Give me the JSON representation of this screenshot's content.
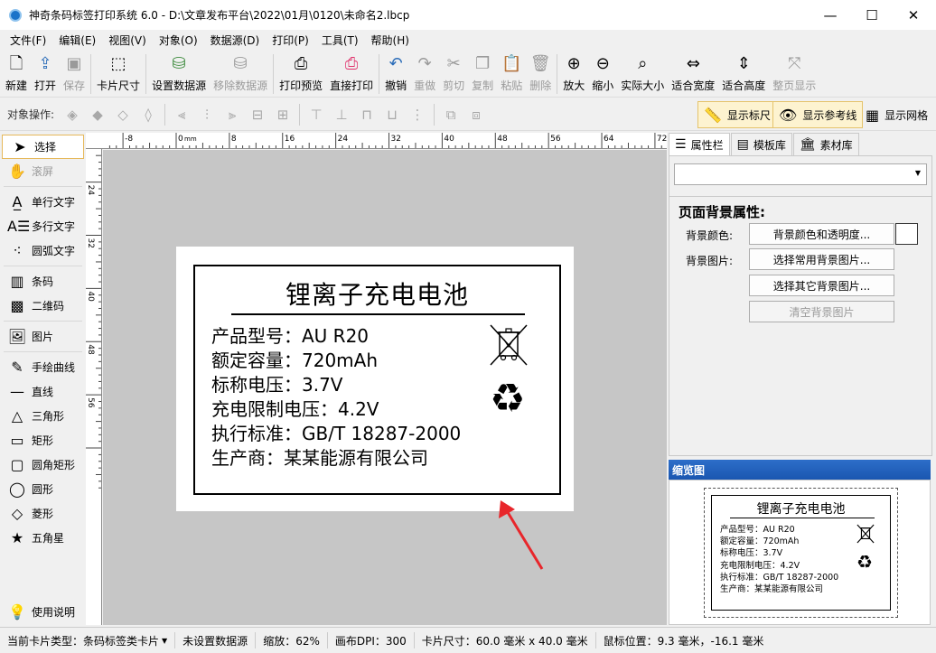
{
  "window": {
    "title": "神奇条码标签打印系统 6.0 - D:\\文章发布平台\\2022\\01月\\0120\\未命名2.lbcp",
    "minimize_glyph": "—",
    "maximize_glyph": "☐",
    "close_glyph": "✕"
  },
  "menu": [
    "文件(F)",
    "编辑(E)",
    "视图(V)",
    "对象(O)",
    "数据源(D)",
    "打印(P)",
    "工具(T)",
    "帮助(H)"
  ],
  "toolbar": {
    "new": "新建",
    "open": "打开",
    "save": "保存",
    "card_size": "卡片尺寸",
    "set_datasource": "设置数据源",
    "remove_datasource": "移除数据源",
    "print_preview": "打印预览",
    "direct_print": "直接打印",
    "undo": "撤销",
    "redo": "重做",
    "cut": "剪切",
    "copy": "复制",
    "paste": "粘贴",
    "delete": "删除",
    "zoom_in": "放大",
    "zoom_out": "缩小",
    "actual_size": "实际大小",
    "fit_width": "适合宽度",
    "fit_height": "适合高度",
    "fit_page": "整页显示"
  },
  "ops": {
    "label": "对象操作:",
    "show_ruler": "显示标尺",
    "show_guides": "显示参考线",
    "show_grid": "显示网格"
  },
  "palette": {
    "select": "选择",
    "scroll": "滚屏",
    "single_text": "单行文字",
    "multi_text": "多行文字",
    "arc_text": "圆弧文字",
    "barcode": "条码",
    "qrcode": "二维码",
    "image": "图片",
    "freehand": "手绘曲线",
    "line": "直线",
    "triangle": "三角形",
    "rectangle": "矩形",
    "rounded_rect": "圆角矩形",
    "ellipse": "圆形",
    "diamond": "菱形",
    "star": "五角星",
    "help": "使用说明"
  },
  "ruler": {
    "h_labels": [
      "-8",
      "0",
      "8",
      "16",
      "24",
      "32",
      "40",
      "48",
      "56",
      "64",
      "72"
    ],
    "h_unit": "mm",
    "v_labels": [
      "8",
      "16",
      "24",
      "32",
      "40",
      "48",
      "56"
    ]
  },
  "label_card": {
    "title": "锂离子充电电池",
    "lines": [
      "产品型号：AU R20",
      "额定容量：720mAh",
      "标称电压：3.7V",
      "充电限制电压：4.2V",
      "执行标准：GB/T 18287-2000",
      "生产商：某某能源有限公司"
    ],
    "recycle_glyph": "♻"
  },
  "right_panel": {
    "tabs": [
      "属性栏",
      "模板库",
      "素材库"
    ],
    "section_title": "页面背景属性:",
    "bg_color_label": "背景颜色:",
    "bg_image_label": "背景图片:",
    "bg_color_btn": "背景颜色和透明度...",
    "common_bg_btn": "选择常用背景图片...",
    "other_bg_btn": "选择其它背景图片...",
    "clear_bg_btn": "清空背景图片",
    "swatch_color": "#ffffff",
    "preview_title": "缩览图"
  },
  "status": {
    "card_type": "当前卡片类型：条码标签类卡片",
    "datasource": "未设置数据源",
    "zoom": "缩放：62%",
    "dpi": "画布DPI：300",
    "card_size": "卡片尺寸：60.0 毫米 x 40.0 毫米",
    "mouse_pos": "鼠标位置：9.3 毫米，-16.1 毫米"
  },
  "colors": {
    "accent_blue": "#1a56b0",
    "arrow_red": "#e8262b",
    "canvas_gray": "#c6c6c6",
    "active_highlight": "#fdf3d0"
  }
}
